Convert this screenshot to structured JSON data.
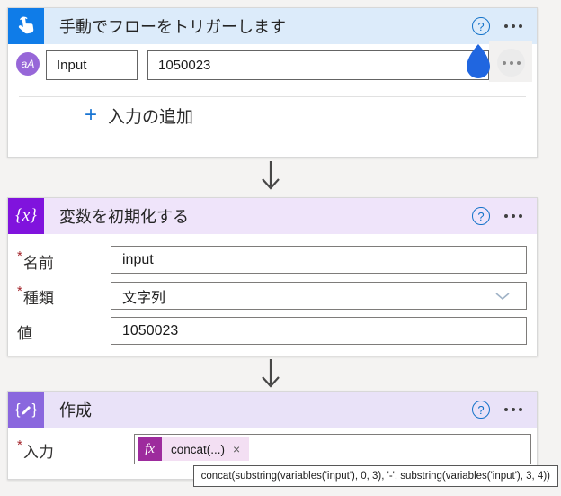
{
  "ui": {
    "required_marker": "*",
    "help_glyph": "?",
    "plus_glyph": "+",
    "close_glyph": "×",
    "colors": {
      "trigger_accent": "#0f7ce8",
      "trigger_header_bg": "#dcebfa",
      "text_type_badge_bg": "#9767d8",
      "variable_accent": "#8013dd",
      "variable_header_bg": "#efe4fa",
      "compose_accent": "#8a67de",
      "compose_header_bg": "#e9e2f8",
      "expression_accent": "#9d2b9d",
      "expression_chip_bg": "#f3dff3",
      "help_blue": "#1372c9",
      "add_input_blue": "#1874d2",
      "drop_handle_blue": "#2066e0"
    }
  },
  "trigger_card": {
    "title": "手動でフローをトリガーします",
    "type_badge": "aA",
    "input_name": "Input",
    "input_value": "1050023",
    "add_input_label": "入力の追加"
  },
  "variable_card": {
    "title": "変数を初期化する",
    "icon_glyph": "{x}",
    "fields": [
      {
        "label": "名前",
        "required": true,
        "value": "input",
        "control": "text"
      },
      {
        "label": "種類",
        "required": true,
        "value": "文字列",
        "control": "dropdown"
      },
      {
        "label": "値",
        "required": false,
        "value": "1050023",
        "control": "text"
      }
    ]
  },
  "compose_card": {
    "title": "作成",
    "field_label": "入力",
    "expression": {
      "fx_glyph": "fx",
      "chip_label": "concat(...)"
    },
    "tooltip": "concat(substring(variables('input'), 0, 3), '-', substring(variables('input'), 3, 4))"
  }
}
